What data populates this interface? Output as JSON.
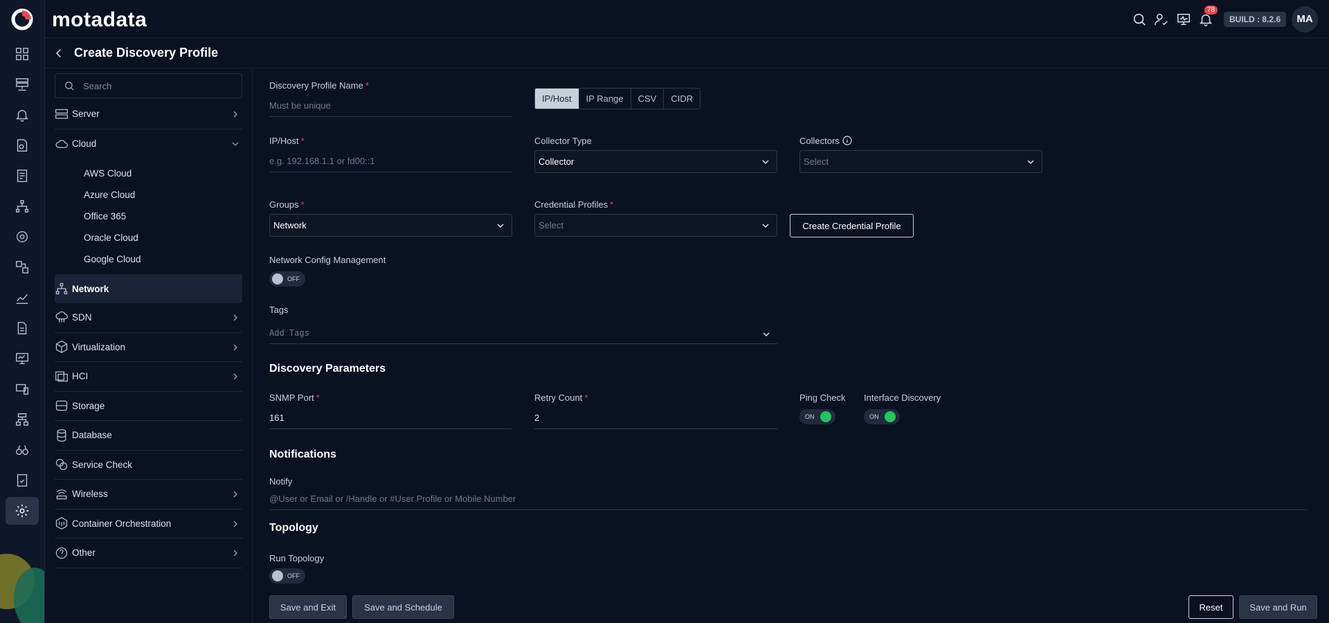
{
  "app": {
    "brand": "motadata",
    "build": "BUILD : 8.2.6",
    "avatar": "MA",
    "notifications": "78"
  },
  "page": {
    "title": "Create Discovery Profile"
  },
  "sidebar": {
    "search_placeholder": "Search",
    "items": [
      {
        "label": "Server",
        "icon": "server-icon"
      },
      {
        "label": "Cloud",
        "icon": "cloud-icon",
        "expanded": true,
        "children": [
          "AWS Cloud",
          "Azure Cloud",
          "Office 365",
          "Oracle Cloud",
          "Google Cloud"
        ]
      },
      {
        "label": "Network",
        "icon": "network-icon",
        "active": true
      },
      {
        "label": "SDN",
        "icon": "sdn-icon"
      },
      {
        "label": "Virtualization",
        "icon": "cube-icon"
      },
      {
        "label": "HCI",
        "icon": "hci-icon"
      },
      {
        "label": "Storage",
        "icon": "storage-icon"
      },
      {
        "label": "Database",
        "icon": "database-icon"
      },
      {
        "label": "Service Check",
        "icon": "service-check-icon"
      },
      {
        "label": "Wireless",
        "icon": "wireless-icon"
      },
      {
        "label": "Container Orchestration",
        "icon": "container-icon"
      },
      {
        "label": "Other",
        "icon": "question-icon"
      }
    ]
  },
  "form": {
    "profile_name": {
      "label": "Discovery Profile Name",
      "placeholder": "Must be unique"
    },
    "modes": [
      "IP/Host",
      "IP Range",
      "CSV",
      "CIDR"
    ],
    "active_mode": "IP/Host",
    "ip_host": {
      "label": "IP/Host",
      "placeholder": "e.g. 192.168.1.1 or fd00::1"
    },
    "collector_type": {
      "label": "Collector Type",
      "value": "Collector"
    },
    "collectors": {
      "label": "Collectors",
      "placeholder": "Select"
    },
    "groups": {
      "label": "Groups",
      "value": "Network"
    },
    "credential_profiles": {
      "label": "Credential Profiles",
      "placeholder": "Select"
    },
    "create_credential_btn": "Create Credential Profile",
    "ncm": {
      "label": "Network Config Management",
      "state": "OFF"
    },
    "tags": {
      "label": "Tags",
      "placeholder": "Add Tags"
    },
    "discovery_params": {
      "title": "Discovery Parameters",
      "snmp_port": {
        "label": "SNMP Port",
        "value": "161"
      },
      "retry_count": {
        "label": "Retry Count",
        "value": "2"
      },
      "ping_check": {
        "label": "Ping Check",
        "state": "ON"
      },
      "interface_discovery": {
        "label": "Interface Discovery",
        "state": "ON"
      }
    },
    "notifications": {
      "title": "Notifications",
      "notify": {
        "label": "Notify",
        "placeholder": "@User or Email or /Handle or #User Profile or Mobile Number"
      }
    },
    "topology": {
      "title": "Topology",
      "run_topology": {
        "label": "Run Topology",
        "state": "OFF"
      }
    }
  },
  "actions": {
    "save_exit": "Save and Exit",
    "save_schedule": "Save and Schedule",
    "reset": "Reset",
    "save_run": "Save and Run"
  },
  "colors": {
    "background": "#0a1120",
    "required": "#e5484d",
    "toggle_on": "#22c55e",
    "badge": "#e5484d"
  }
}
